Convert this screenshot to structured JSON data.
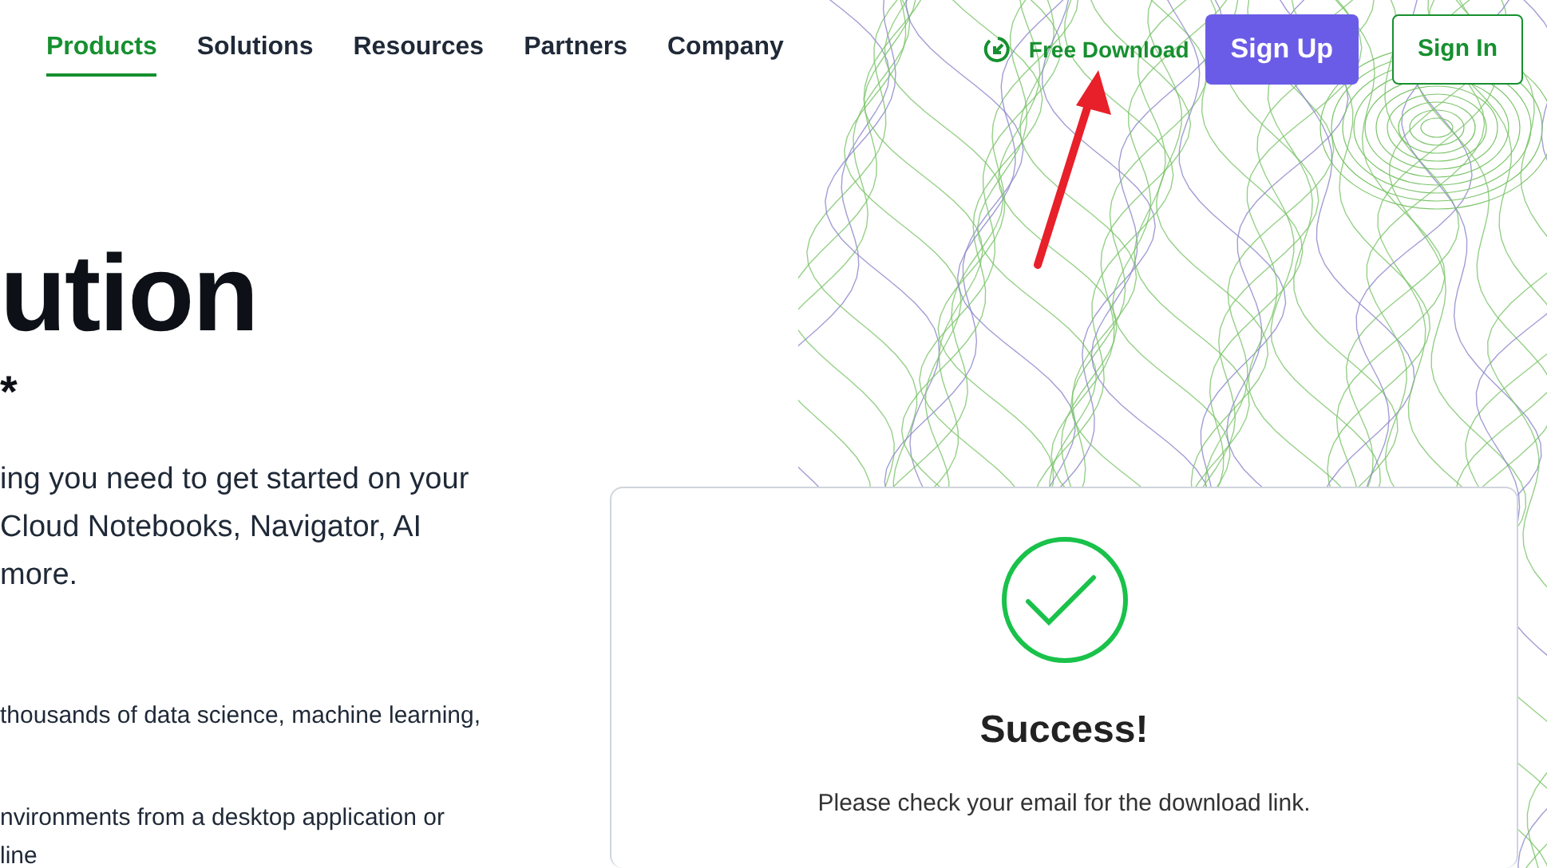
{
  "nav": {
    "links": [
      {
        "label": "Products",
        "selected": true
      },
      {
        "label": "Solutions",
        "selected": false
      },
      {
        "label": "Resources",
        "selected": false
      },
      {
        "label": "Partners",
        "selected": false
      },
      {
        "label": "Company",
        "selected": false
      }
    ],
    "free_download": "Free Download",
    "sign_up": "Sign Up",
    "sign_in": "Sign In"
  },
  "hero": {
    "title": "ution",
    "subtitle": "*",
    "lead_lines": [
      "ing you need to get started on your",
      "Cloud Notebooks, Navigator, AI",
      "more."
    ],
    "details": [
      {
        "lines": [
          "thousands of data science, machine learning,"
        ]
      },
      {
        "lines": [
          "nvironments from a desktop application or",
          "line"
        ]
      }
    ]
  },
  "success_card": {
    "title": "Success!",
    "message": "Please check your email for the download link."
  }
}
